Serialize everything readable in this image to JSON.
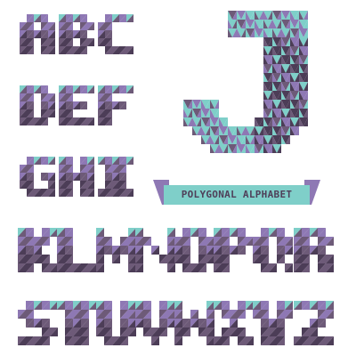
{
  "rows": [
    {
      "letters": [
        "A",
        "B",
        "C"
      ]
    },
    {
      "letters": [
        "D",
        "E",
        "F"
      ]
    },
    {
      "letters": [
        "G",
        "H",
        "I"
      ]
    },
    {
      "letters": [
        "K",
        "L",
        "M",
        "N",
        "O",
        "P",
        "Q",
        "R"
      ]
    },
    {
      "letters": [
        "S",
        "T",
        "U",
        "V",
        "W",
        "X",
        "Y",
        "Z"
      ]
    }
  ],
  "featured_letter": "J",
  "ribbon": {
    "label": "POLYGONAL ALPHABET"
  },
  "colors": {
    "teal": "#7fcfc9",
    "purple": "#8e78b4",
    "dark_plum": "#4c3d57",
    "mauve": "#6d5a78"
  }
}
